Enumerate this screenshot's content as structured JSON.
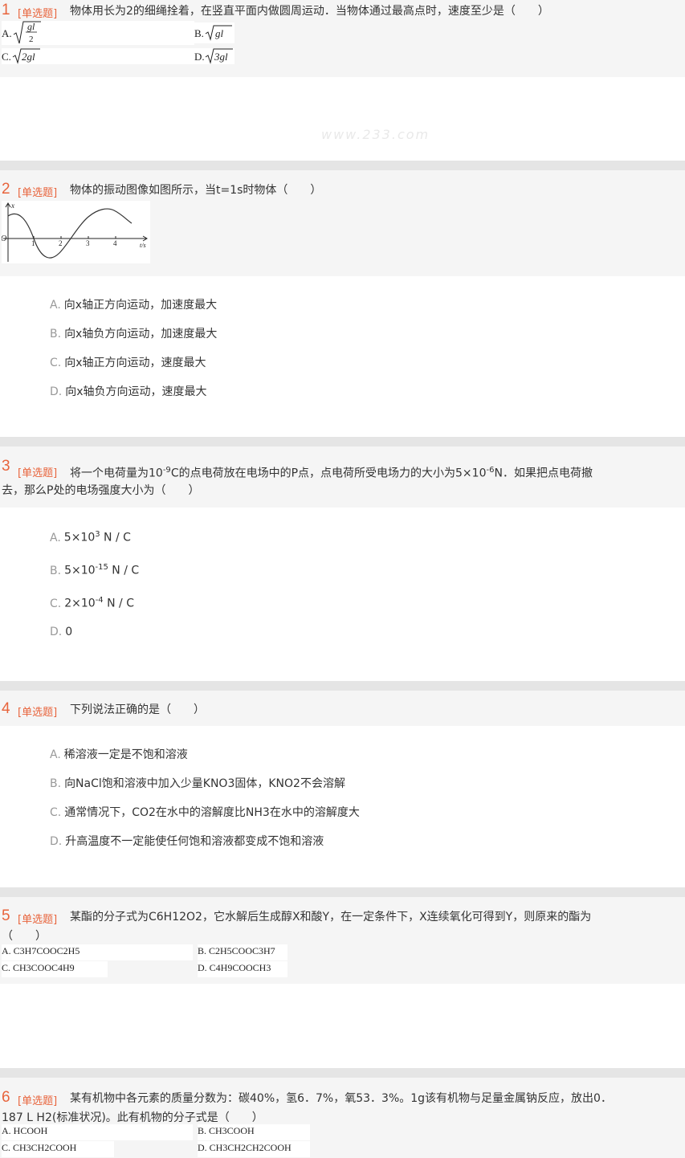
{
  "watermark": "www.233.com",
  "questions": [
    {
      "num": "1",
      "tag": "[单选题]",
      "text": "物体用长为2的细绳拴着，在竖直平面内做圆周运动．当物体通过最高点时，速度至少是（　　）",
      "options": [
        "A.",
        "B.",
        "C.",
        "D."
      ]
    },
    {
      "num": "2",
      "tag": "[单选题]",
      "text": "物体的振动图像如图所示，当t=1s时物体（　　）",
      "graph": {
        "x_axis_label": "t/s",
        "y_axis_label": "x",
        "origin": "O",
        "ticks": [
          "1",
          "2",
          "3",
          "4"
        ]
      },
      "options": [
        {
          "letter": "A.",
          "text": "向x轴正方向运动，加速度最大"
        },
        {
          "letter": "B.",
          "text": "向x轴负方向运动，加速度最大"
        },
        {
          "letter": "C.",
          "text": "向x轴正方向运动，速度最大"
        },
        {
          "letter": "D.",
          "text": "向x轴负方向运动，速度最大"
        }
      ]
    },
    {
      "num": "3",
      "tag": "[单选题]",
      "text_a": "将一个电荷量为10",
      "text_sup1": "-9",
      "text_b": "C的点电荷放在电场中的P点，点电荷所受电场力的大小为5×10",
      "text_sup2": "-6",
      "text_c": "N．如果把点电荷撤",
      "text_line2": "去，那么P处的电场强度大小为（　　）",
      "options": [
        {
          "letter": "A.",
          "base": "5×10",
          "exp": "3",
          "unit": " N / C"
        },
        {
          "letter": "B.",
          "base": "5×10",
          "exp": "-15",
          "unit": " N / C"
        },
        {
          "letter": "C.",
          "base": "2×10",
          "exp": "-4",
          "unit": " N / C"
        },
        {
          "letter": "D.",
          "base": "0",
          "exp": "",
          "unit": ""
        }
      ]
    },
    {
      "num": "4",
      "tag": "[单选题]",
      "text": "下列说法正确的是（　　）",
      "options": [
        {
          "letter": "A.",
          "text": "稀溶液一定是不饱和溶液"
        },
        {
          "letter": "B.",
          "text": "向NaCl饱和溶液中加入少量KNO3固体，KNO2不会溶解"
        },
        {
          "letter": "C.",
          "text": "通常情况下，CO2在水中的溶解度比NH3在水中的溶解度大"
        },
        {
          "letter": "D.",
          "text": "升高温度不一定能使任何饱和溶液都变成不饱和溶液"
        }
      ]
    },
    {
      "num": "5",
      "tag": "[单选题]",
      "text": "某酯的分子式为C6H12O2，它水解后生成醇X和酸Y，在一定条件下，X连续氧化可得到Y，则原来的酯为",
      "text_line2": "（　　）",
      "options": [
        "A. C3H7COOC2H5",
        "B. C2H5COOC3H7",
        "C. CH3COOC4H9",
        "D. C4H9COOCH3"
      ]
    },
    {
      "num": "6",
      "tag": "[单选题]",
      "text": "某有机物中各元素的质量分数为：碳40%，氢6．7%，氧53．3%。1g该有机物与足量金属钠反应，放出0．",
      "text_line2": "187 L H2(标准状况)。此有机物的分子式是（　　）",
      "options": [
        "A. HCOOH",
        "B. CH3COOH",
        "C. CH3CH2COOH",
        "D. CH3CH2CH2COOH"
      ]
    }
  ]
}
